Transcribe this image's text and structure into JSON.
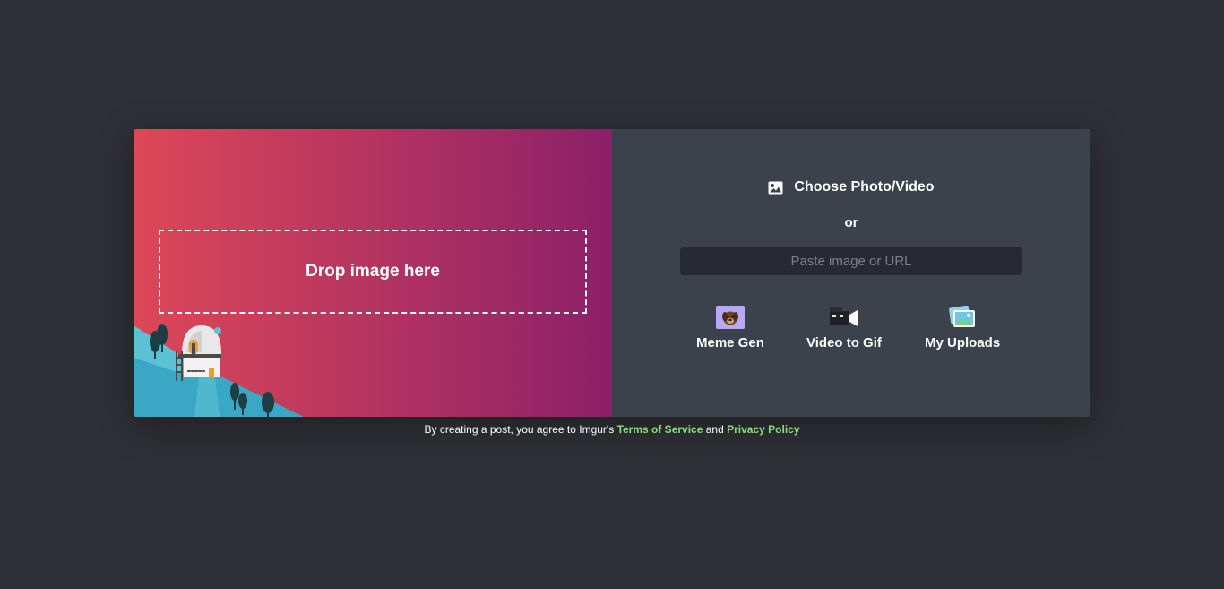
{
  "dropzone": {
    "label": "Drop image here"
  },
  "upload": {
    "choose_label": "Choose Photo/Video",
    "or_label": "or",
    "paste_placeholder": "Paste image or URL"
  },
  "tools": [
    {
      "label": "Meme Gen",
      "icon": "meme-gen-icon"
    },
    {
      "label": "Video to Gif",
      "icon": "video-camera-icon"
    },
    {
      "label": "My Uploads",
      "icon": "photos-icon"
    }
  ],
  "footer": {
    "prefix": "By creating a post, you agree to Imgur's",
    "terms_label": "Terms of Service",
    "and_label": "and",
    "privacy_label": "Privacy Policy"
  },
  "colors": {
    "background": "#2f3035",
    "gradient_start": "#dd4857",
    "gradient_end": "#8b2068",
    "right_panel": "#3b424c",
    "input_bg": "#282a33",
    "link_green": "#86e07a"
  }
}
